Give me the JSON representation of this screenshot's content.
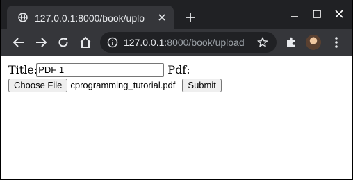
{
  "tab": {
    "title": "127.0.0.1:8000/book/uplo"
  },
  "omnibox": {
    "url_host": "127.0.0.1",
    "url_rest": ":8000/book/upload"
  },
  "form": {
    "title_label": "Title:",
    "title_value": "PDF 1",
    "pdf_label": "Pdf:",
    "choose_file_label": "Choose File",
    "chosen_file": "cprogramming_tutorial.pdf",
    "submit_label": "Submit"
  },
  "icons": {
    "tab_favicon": "globe-icon",
    "tab_close": "close-icon",
    "new_tab": "plus-icon",
    "minimize": "minimize-icon",
    "maximize": "maximize-icon",
    "close_window": "close-icon",
    "back": "back-arrow-icon",
    "forward": "forward-arrow-icon",
    "reload": "reload-icon",
    "home": "home-icon",
    "site_info": "info-icon",
    "bookmark": "star-icon",
    "extensions": "puzzle-icon",
    "profile": "avatar",
    "menu": "kebab-menu-icon"
  },
  "colors": {
    "frame": "#202124",
    "toolbar": "#35363a",
    "omnibox": "#202124",
    "text_light": "#e8eaed",
    "text_dim": "#9aa0a6",
    "page_bg": "#ffffff"
  }
}
